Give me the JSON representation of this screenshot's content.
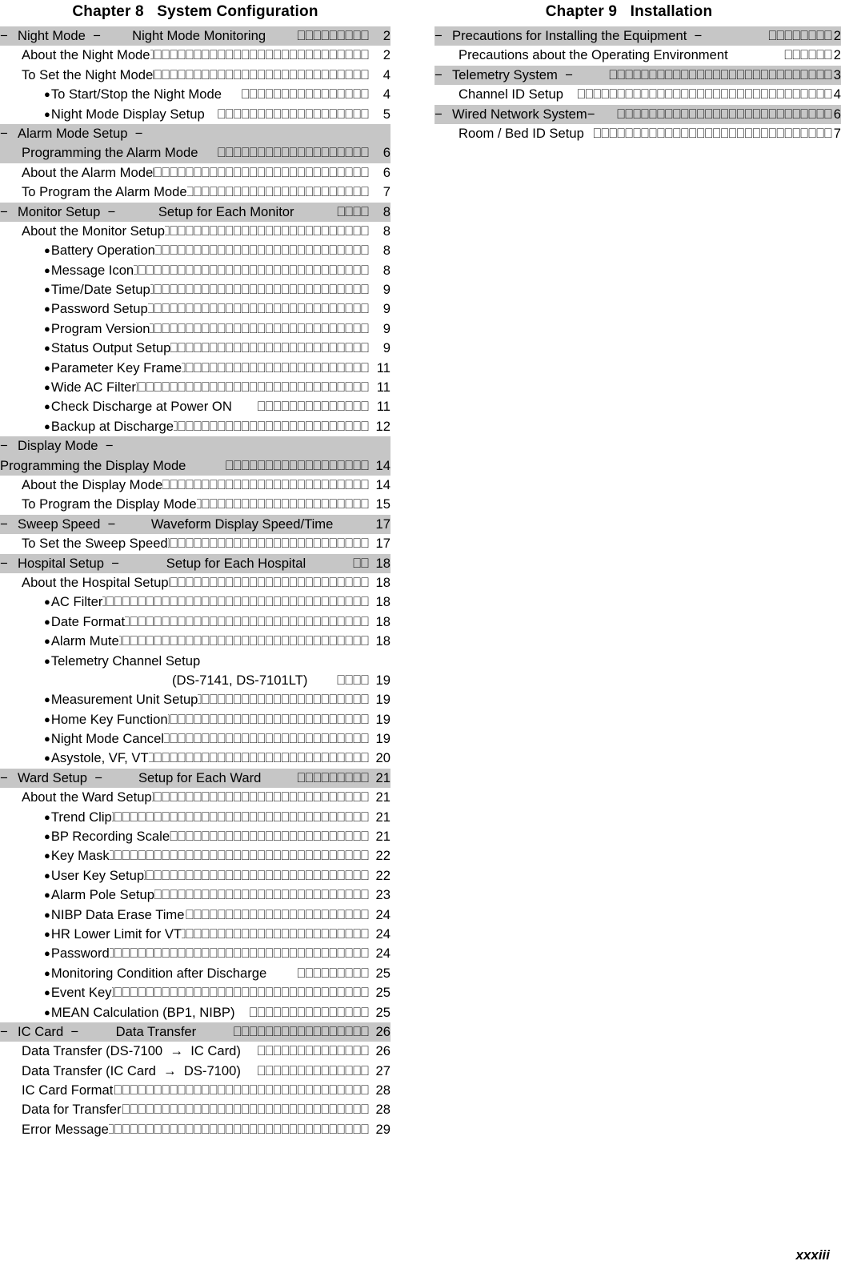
{
  "folio": "xxxiii",
  "leader_char": "⎕",
  "left_column": {
    "chapter_heading": "Chapter 8   System Configuration",
    "rows": [
      {
        "kind": "band-head",
        "dash": "−",
        "label": "Night Mode  −",
        "second": "Night Mode Monitoring",
        "leader": 9,
        "page": "2"
      },
      {
        "kind": "item1",
        "label": "About the Night Mode",
        "leader": 30,
        "page": "2"
      },
      {
        "kind": "item1",
        "label": "To Set the Night Mode",
        "leader": 28,
        "page": "4"
      },
      {
        "kind": "item2",
        "label": "To Start/Stop the Night Mode",
        "leader": 16,
        "page": "4"
      },
      {
        "kind": "item2",
        "label": "Night Mode Display Setup",
        "leader": 19,
        "page": "5"
      },
      {
        "kind": "band-plain",
        "dash": "−",
        "label": "Alarm Mode Setup  −"
      },
      {
        "kind": "band-sub",
        "label": "Programming the Alarm Mode",
        "leader": 19,
        "page": "6"
      },
      {
        "kind": "item1",
        "label": "About the Alarm Mode",
        "leader": 30,
        "page": "6"
      },
      {
        "kind": "item1",
        "label": "To Program the Alarm Mode",
        "leader": 25,
        "page": "7"
      },
      {
        "kind": "band-head",
        "dash": "−",
        "label": "Monitor Setup  −",
        "second": "Setup for Each Monitor",
        "leader": 4,
        "page": "8"
      },
      {
        "kind": "item1",
        "label": "About the Monitor Setup",
        "leader": 30,
        "page": "8"
      },
      {
        "kind": "item2",
        "label": "Battery Operation",
        "leader": 30,
        "page": "8"
      },
      {
        "kind": "item2",
        "label": "Message Icon",
        "leader": 33,
        "page": "8"
      },
      {
        "kind": "item2",
        "label": "Time/Date Setup",
        "leader": 29,
        "page": "9"
      },
      {
        "kind": "item2",
        "label": "Password Setup",
        "leader": 31,
        "page": "9"
      },
      {
        "kind": "item2",
        "label": "Program Version",
        "leader": 29,
        "page": "9"
      },
      {
        "kind": "item2",
        "label": "Status Output Setup",
        "leader": 27,
        "page": "9"
      },
      {
        "kind": "item2",
        "label": "Parameter Key Frame",
        "leader": 25,
        "page": "11"
      },
      {
        "kind": "item2",
        "label": "Wide AC Filter",
        "leader": 31,
        "page": "11"
      },
      {
        "kind": "item2",
        "label": "Check Discharge at Power ON",
        "leader": 14,
        "page": "11"
      },
      {
        "kind": "item2",
        "label": "Backup at Discharge",
        "leader": 26,
        "page": "12"
      },
      {
        "kind": "band-plain",
        "dash": "−",
        "label": "Display Mode  −"
      },
      {
        "kind": "band-sub0",
        "label": "Programming the Display Mode",
        "leader": 18,
        "page": "14"
      },
      {
        "kind": "item1",
        "label": "About the Display Mode",
        "leader": 27,
        "page": "14"
      },
      {
        "kind": "item1",
        "label": "To Program the Display Mode",
        "leader": 23,
        "page": "15"
      },
      {
        "kind": "band-head",
        "dash": "−",
        "label": "Sweep Speed  −",
        "second": "Waveform Display Speed/Time",
        "leader": 0,
        "page": "17"
      },
      {
        "kind": "item1",
        "label": "To Set the Sweep Speed",
        "leader": 27,
        "page": "17"
      },
      {
        "kind": "band-head",
        "dash": "−",
        "label": "Hospital Setup  −",
        "second": "Setup for Each Hospital",
        "leader": 2,
        "page": "18"
      },
      {
        "kind": "item1",
        "label": "About the Hospital Setup",
        "leader": 27,
        "page": "18"
      },
      {
        "kind": "item2",
        "label": "AC Filter",
        "leader": 35,
        "page": "18"
      },
      {
        "kind": "item2",
        "label": "Date Format",
        "leader": 33,
        "page": "18"
      },
      {
        "kind": "item2",
        "label": "Alarm Mute",
        "leader": 34,
        "page": "18"
      },
      {
        "kind": "item2-nolead",
        "label": "Telemetry Channel Setup"
      },
      {
        "kind": "wrap",
        "label": "(DS-7141, DS-7101LT)",
        "leader": 4,
        "page": "19"
      },
      {
        "kind": "item2",
        "label": "Measurement Unit Setup",
        "leader": 22,
        "page": "19"
      },
      {
        "kind": "item2",
        "label": "Home Key Function",
        "leader": 26,
        "page": "19"
      },
      {
        "kind": "item2",
        "label": "Night Mode Cancel",
        "leader": 26,
        "page": "19"
      },
      {
        "kind": "item2",
        "label": "Asystole, VF, VT",
        "leader": 28,
        "page": "20"
      },
      {
        "kind": "band-head",
        "dash": "−",
        "label": "Ward Setup  −",
        "second": "Setup for Each Ward",
        "leader": 9,
        "page": "21"
      },
      {
        "kind": "item1",
        "label": "About the Ward Setup",
        "leader": 30,
        "page": "21"
      },
      {
        "kind": "item2",
        "label": "Trend Clip",
        "leader": 34,
        "page": "21"
      },
      {
        "kind": "item2",
        "label": "BP Recording Scale",
        "leader": 26,
        "page": "21"
      },
      {
        "kind": "item2",
        "label": "Key Mask",
        "leader": 34,
        "page": "22"
      },
      {
        "kind": "item2",
        "label": "User Key Setup",
        "leader": 30,
        "page": "22"
      },
      {
        "kind": "item2",
        "label": "Alarm Pole Setup",
        "leader": 29,
        "page": "23"
      },
      {
        "kind": "item2",
        "label": "NIBP Data Erase Time",
        "leader": 23,
        "page": "24"
      },
      {
        "kind": "item2",
        "label": "HR Lower Limit for VT",
        "leader": 24,
        "page": "24"
      },
      {
        "kind": "item2",
        "label": "Password",
        "leader": 33,
        "page": "24"
      },
      {
        "kind": "item2",
        "label": "Monitoring Condition after Discharge",
        "leader": 9,
        "page": "25"
      },
      {
        "kind": "item2",
        "label": "Event Key",
        "leader": 33,
        "page": "25"
      },
      {
        "kind": "item2",
        "label": "MEAN Calculation (BP1, NIBP)",
        "leader": 15,
        "page": "25"
      },
      {
        "kind": "band-head",
        "dash": "−",
        "label": "IC Card  −",
        "second": "Data Transfer",
        "leader": 17,
        "page": "26"
      },
      {
        "kind": "item1",
        "label": "Data Transfer (DS-7100  →  IC Card)",
        "leader": 14,
        "page": "26"
      },
      {
        "kind": "item1",
        "label": "Data Transfer (IC Card  →  DS-7100)",
        "leader": 14,
        "page": "27"
      },
      {
        "kind": "item1",
        "label": "IC Card Format",
        "leader": 32,
        "page": "28"
      },
      {
        "kind": "item1",
        "label": "Data for Transfer",
        "leader": 31,
        "page": "28"
      },
      {
        "kind": "item1",
        "label": "Error Message",
        "leader": 35,
        "page": "29"
      }
    ]
  },
  "right_column": {
    "chapter_heading": "Chapter 9   Installation",
    "rows": [
      {
        "kind": "band-head-r",
        "dash": "−",
        "label": "Precautions for Installing the Equipment  −",
        "leader": 8,
        "page": "2"
      },
      {
        "kind": "item1r",
        "label": "Precautions about the Operating Environment",
        "leader": 6,
        "page": "2"
      },
      {
        "kind": "band-head-r",
        "dash": "−",
        "label": "Telemetry System  −",
        "leader": 28,
        "page": "3"
      },
      {
        "kind": "item1r",
        "label": "Channel ID Setup",
        "leader": 32,
        "page": "4"
      },
      {
        "kind": "band-head-r",
        "dash": "−",
        "label": "Wired Network System−",
        "leader": 27,
        "page": "6"
      },
      {
        "kind": "item1r",
        "label": "Room / Bed ID Setup",
        "leader": 30,
        "page": "7"
      }
    ]
  }
}
